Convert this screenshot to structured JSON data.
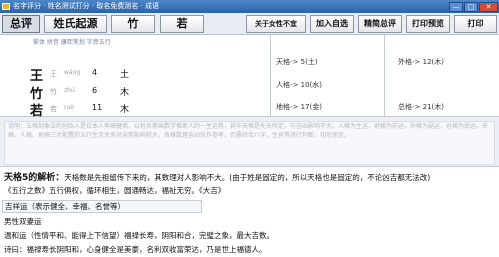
{
  "window": {
    "title": "名字评分 · 姓名测试打分 · 取名免费测名 · 成语",
    "minimize": "—",
    "maximize": "□",
    "close": "✕"
  },
  "toolbar": {
    "score": "总评",
    "origin": "姓氏起源",
    "char1": "竹",
    "char2": "若",
    "about_gender": "关于女性不宜",
    "add_favorite": "加入自选",
    "detail_review": "精简总评",
    "print_preview": "打印预览",
    "print": "打印"
  },
  "name_table": {
    "header": "繁体 拼音 康熙笔划 字意五行",
    "rows": [
      {
        "char": "王",
        "trad": "王",
        "pinyin": "wáng",
        "strokes": "4",
        "element": "土"
      },
      {
        "char": "竹",
        "trad": "竹",
        "pinyin": "zhú",
        "strokes": "6",
        "element": "木"
      },
      {
        "char": "若",
        "trad": "若",
        "pinyin": "ruò",
        "strokes": "11",
        "element": "木"
      }
    ]
  },
  "grids": {
    "tian": {
      "label": "天格->",
      "value": "5(土)"
    },
    "ren": {
      "label": "人格->",
      "value": "10(水)"
    },
    "di": {
      "label": "地格->",
      "value": "17(金)"
    },
    "wai": {
      "label": "外格->",
      "value": "12(木)"
    },
    "zong": {
      "label": "总格->",
      "value": "21(木)"
    }
  },
  "notes": "说明：五格剖象法的创始人是日本人熊崎健翁，以姓名笔画数字推断人的一生运势，其中天格是先天所定，与吉凶影响不大。人格为主运，地格为前运，外格为副运，总格为后运。天格、人格、地格三才配置的五行生克关系对运势影响较大，各格数理吉凶仅作参考，仍需综合八字、生肖等进行判断，切勿迷信。",
  "analysis": {
    "heading": "天格5的解析：",
    "heading_text": "天格数是先祖留传下来的，其数理对人影响不大。(由于姓是固定的，所以天格也是固定的，不论凶吉都无法改)",
    "line2": "《五行之数》五行俱权，循环相生，圆通畅达，福祉无穷。《大吉》",
    "line3": "吉祥运（表示健全、幸福、名誉等）",
    "line4": "男性双妻运",
    "line5": "温和运（性情平和、能得上下信望）福禄长寿，阴阳和合，完璧之象，最大吉数。",
    "line6": "诗曰：福禄寿长阴阳和，心身健全是美豪，名利双收富荣达，乃是世上福德人。"
  }
}
